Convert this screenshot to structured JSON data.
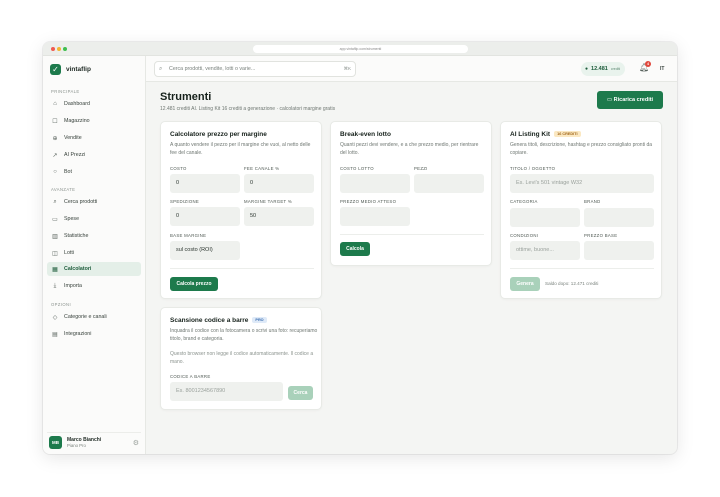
{
  "browser": {
    "url": "app.vintaflip.com/strumenti"
  },
  "app": {
    "name": "vintaflip"
  },
  "sidebar": {
    "section_main": "PRINCIPALE",
    "section_advanced": "AVANZATE",
    "section_other": "OPZIONI",
    "items_main": [
      {
        "label": "Dashboard",
        "icon": "home-icon"
      },
      {
        "label": "Magazzino",
        "icon": "box-icon"
      },
      {
        "label": "Vendite",
        "icon": "cart-icon"
      },
      {
        "label": "AI Prezzi",
        "icon": "trend-icon"
      },
      {
        "label": "Bot",
        "icon": "bot-icon"
      }
    ],
    "items_advanced": [
      {
        "label": "Cerca prodotti",
        "icon": "search-icon"
      },
      {
        "label": "Spese",
        "icon": "receipt-icon"
      },
      {
        "label": "Statistiche",
        "icon": "bar-chart-icon"
      },
      {
        "label": "Lotti",
        "icon": "layers-icon"
      },
      {
        "label": "Calcolatori",
        "icon": "calculator-icon"
      },
      {
        "label": "Importa",
        "icon": "download-icon"
      }
    ],
    "items_other": [
      {
        "label": "Categorie e canali",
        "icon": "tag-icon"
      },
      {
        "label": "Integrazioni",
        "icon": "plug-icon"
      }
    ],
    "active": "Calcolatori",
    "user": {
      "initials": "MB",
      "name": "Marco Bianchi",
      "plan": "Piano Pro"
    }
  },
  "topbar": {
    "search_placeholder": "Cerca prodotti, vendite, lotti o varie...",
    "search_shortcut": "⌘K",
    "credits": "12.481",
    "credits_unit": "crediti",
    "notifications": "4",
    "lang": "IT"
  },
  "page": {
    "title": "Strumenti",
    "subtitle": "12.481 crediti AI. Listing Kit 16 crediti a generazione · calcolatori margine gratis",
    "recharge_label": "Ricarica crediti"
  },
  "margin_calc": {
    "title": "Calcolatore prezzo per margine",
    "desc": "A quanto vendere il pezzo per il margine che vuoi, al netto delle fee del canale.",
    "cost_label": "COSTO",
    "cost_value": "0",
    "fee_label": "FEE CANALE %",
    "fee_value": "0",
    "ship_label": "SPEDIZIONE",
    "ship_value": "0",
    "target_label": "MARGINE TARGET %",
    "target_value": "50",
    "base_label": "BASE MARGINE",
    "base_value": "sul costo (ROI)",
    "button": "Calcola prezzo"
  },
  "breakeven": {
    "title": "Break-even lotto",
    "desc": "Quanti pezzi devi vendere, e a che prezzo medio, per rientrare del lotto.",
    "cost_label": "COSTO LOTTO",
    "pieces_label": "PEZZI",
    "avg_label": "PREZZO MEDIO ATTESO",
    "button": "Calcola"
  },
  "listing_kit": {
    "title": "AI Listing Kit",
    "badge": "16 CREDITI",
    "desc": "Genera titoli, descrizione, hashtag e prezzo consigliato pronti da copiare.",
    "title_label": "TITOLO / OGGETTO",
    "title_placeholder": "Es. Levi's 501 vintage W32",
    "category_label": "CATEGORIA",
    "brand_label": "BRAND",
    "condition_label": "CONDIZIONI",
    "condition_value": "ottime, buone...",
    "base_price_label": "PREZZO BASE",
    "button": "Genera",
    "balance_note": "Saldo dopo: 12.471 crediti"
  },
  "barcode": {
    "title": "Scansione codice a barre",
    "badge": "PRO",
    "desc": "Inquadra il codice con la fotocamera o scrivi una foto: recuperiamo titolo, brand e categoria.",
    "note": "Questo browser non legge il codice automaticamente. Il codice a mano.",
    "code_label": "CODICE A BARRE",
    "code_placeholder": "Es. 8001234567890",
    "button": "Cerca"
  }
}
